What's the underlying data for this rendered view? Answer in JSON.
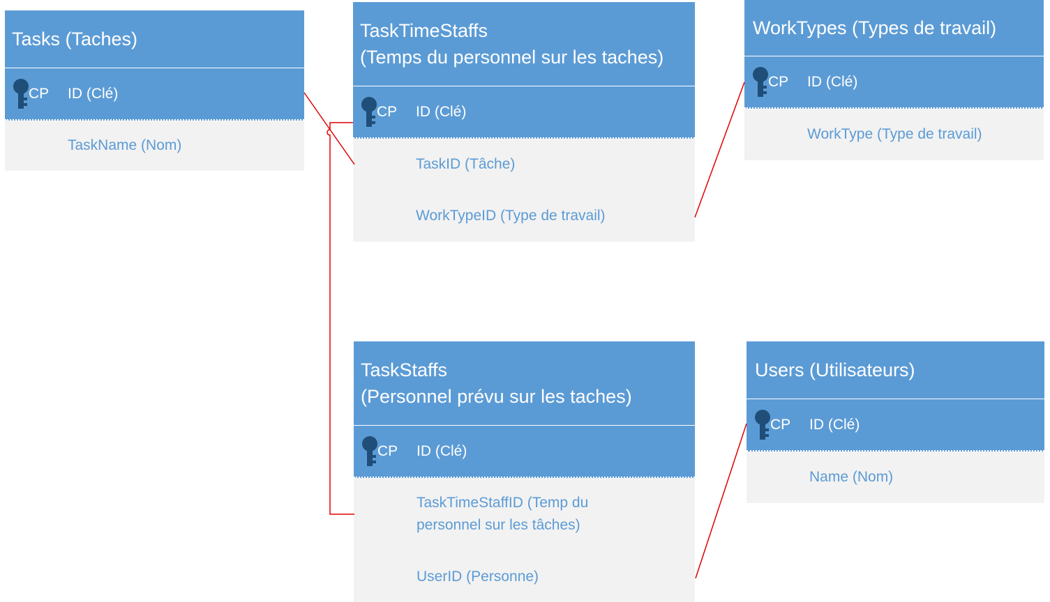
{
  "colors": {
    "header": "#5b9bd5",
    "body": "#f2f2f2",
    "field_text": "#5b9bd5",
    "pk_icon": "#1f4e79",
    "link": "#e00000"
  },
  "tasks": {
    "title": "Tasks (Taches)",
    "pk_tag": "CP",
    "pk_field": "ID (Clé)",
    "fields": [
      "TaskName (Nom)"
    ]
  },
  "task_time_staffs": {
    "title_line1": "TaskTimeStaffs",
    "title_line2": "(Temps du personnel sur les taches)",
    "pk_tag": "CP",
    "pk_field": "ID (Clé)",
    "fields": [
      "TaskID (Tâche)",
      "WorkTypeID (Type de travail)"
    ]
  },
  "work_types": {
    "title": "WorkTypes (Types de travail)",
    "pk_tag": "CP",
    "pk_field": "ID (Clé)",
    "fields": [
      "WorkType (Type de travail)"
    ]
  },
  "task_staffs": {
    "title_line1": "TaskStaffs",
    "title_line2": "(Personnel prévu sur les taches)",
    "pk_tag": "CP",
    "pk_field": "ID (Clé)",
    "fields": [
      "TaskTimeStaffID (Temp du",
      "personnel sur les tâches)",
      "UserID (Personne)"
    ]
  },
  "users": {
    "title": "Users (Utilisateurs)",
    "pk_tag": "CP",
    "pk_field": "ID (Clé)",
    "fields": [
      "Name (Nom)"
    ]
  }
}
